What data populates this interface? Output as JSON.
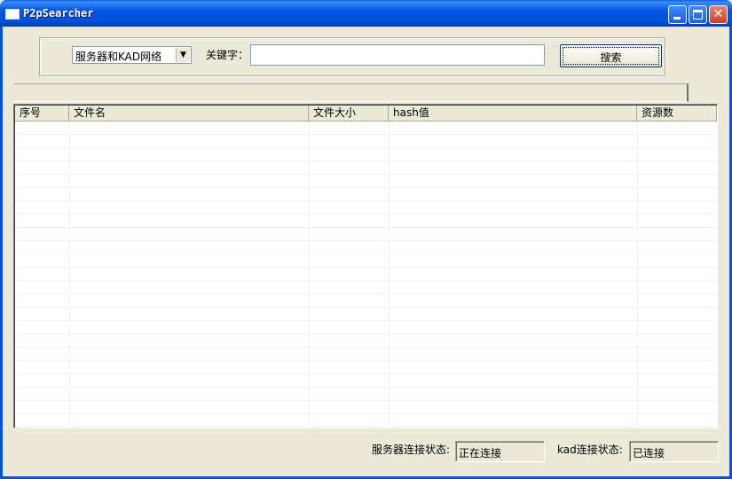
{
  "window": {
    "title": "P2pSearcher"
  },
  "search": {
    "network_select": "服务器和KAD网络",
    "keyword_label": "关键字：",
    "keyword_value": "",
    "search_button": "搜索"
  },
  "progress": {
    "value": 0
  },
  "table": {
    "columns": [
      "序号",
      "文件名",
      "文件大小",
      "hash值",
      "资源数"
    ],
    "rows": []
  },
  "status": {
    "server_label": "服务器连接状态:",
    "server_value": "正在连接",
    "kad_label": "kad连接状态:",
    "kad_value": "已连接"
  }
}
